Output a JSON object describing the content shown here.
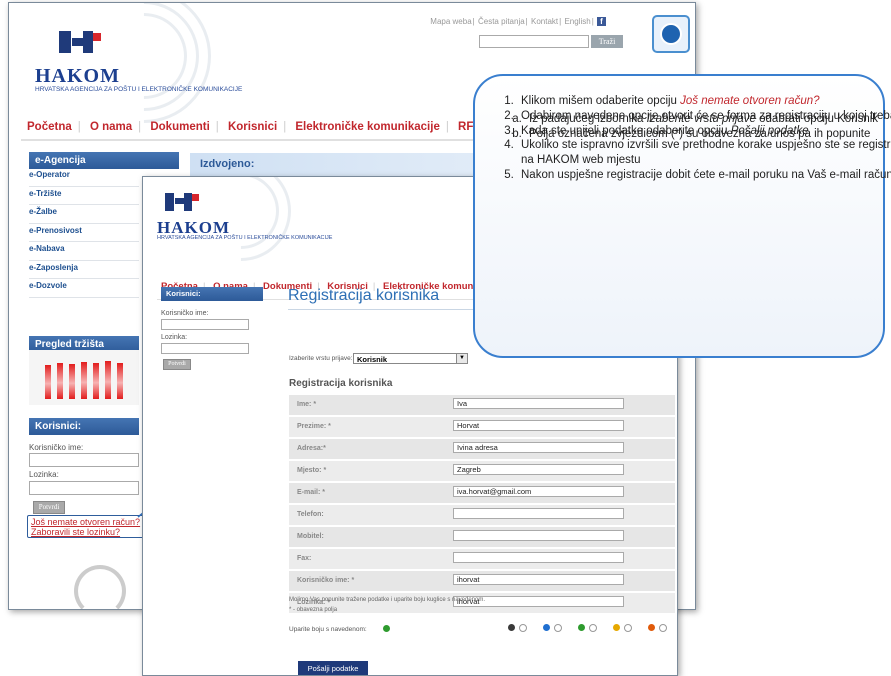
{
  "topnav": {
    "items": [
      "Mapa weba",
      "Česta pitanja",
      "Kontakt",
      "English"
    ],
    "fb": "f"
  },
  "search": {
    "button": "Traži"
  },
  "logo": {
    "word": "HAKOM",
    "subtitle": "HRVATSKA AGENCIJA ZA POŠTU I ELEKTRONIČKE KOMUNIKACIJE"
  },
  "mainnav": [
    "Početna",
    "O nama",
    "Dokumenti",
    "Korisnici",
    "Elektroničke komunikacije",
    "RF"
  ],
  "frontnav": [
    "Početna",
    "O nama",
    "Dokumenti",
    "Korisnici",
    "Elektroničke komunika"
  ],
  "sidebar": {
    "agency_title": "e-Agencija",
    "items": [
      "e-Operator",
      "e-Tržište",
      "e-Žalbe",
      "e-Prenosivost",
      "e-Nabava",
      "e-Zaposlenja",
      "e-Dozvole"
    ],
    "market_title": "Pregled tržišta",
    "users_title": "Korisnici:",
    "username_label": "Korisničko ime:",
    "password_label": "Lozinka:",
    "login_button": "Potvrdi",
    "no_account_link": "Još nemate otvoren račun?",
    "forgot_link": "Zaboravili ste lozinku?"
  },
  "featured": "Izdvojeno:",
  "front_sidebar": {
    "title": "Korisnici:",
    "username_label": "Korisničko ime:",
    "password_label": "Lozinka:",
    "login_button": "Potvrdi"
  },
  "registration": {
    "title": "Registracija korisnika",
    "type_label": "Izaberite vrstu prijave:",
    "type_value": "Korisnik",
    "subtitle": "Registracija korisnika",
    "fields": [
      {
        "label": "Ime: *",
        "value": "Iva"
      },
      {
        "label": "Prezime: *",
        "value": "Horvat"
      },
      {
        "label": "Adresa:*",
        "value": "Ivina adresa"
      },
      {
        "label": "Mjesto: *",
        "value": "Zagreb"
      },
      {
        "label": "E-mail: *",
        "value": "iva.horvat@gmail.com"
      },
      {
        "label": "Telefon:",
        "value": ""
      },
      {
        "label": "Mobitel:",
        "value": ""
      },
      {
        "label": "Fax:",
        "value": ""
      },
      {
        "label": "Korisničko ime: *",
        "value": "ihorvat"
      },
      {
        "label": "Lozinka: *",
        "value": "ihorvat"
      }
    ],
    "note1": "Molimo Vas popunite tražene podatke i uparite boju kuglice s navedenom.",
    "note2": "* - obavezna polja",
    "color_label": "Uparite boju s navedenom:",
    "submit": "Pošalji podatke",
    "colors": {
      "target": "#2e9b2e",
      "options": [
        "#3a3a3a",
        "#1f6fd0",
        "#2e9b2e",
        "#e6a800",
        "#e05a0a"
      ]
    }
  },
  "instructions": {
    "item1_prefix": "Klikom mišem odaberite opciju ",
    "item1_link": "Još nemate otvoren račun?",
    "item2": "Odabirom navedene opcije otvorit će se forma za registraciju u kojoj trebate:",
    "item2a_prefix": "Iz padajućeg izbornika ",
    "item2a_em": "Izaberite vrstu prijave",
    "item2a_suffix": " odabrati opciju Korisnik",
    "item2b": "Polja označena zvjezdicom (*) su obavezna za unos pa ih popunite",
    "item3_prefix": "Kada ste unijeli podatke odaberite opciju ",
    "item3_em": "Pošalji podatke",
    "item4": "Ukoliko ste ispravno izvršili sve prethodne korake uspješno ste se registrirali na HAKOM web mjestu",
    "item5": "Nakon uspješne registracije dobit ćete e-mail poruku na Vaš e-mail račun."
  }
}
